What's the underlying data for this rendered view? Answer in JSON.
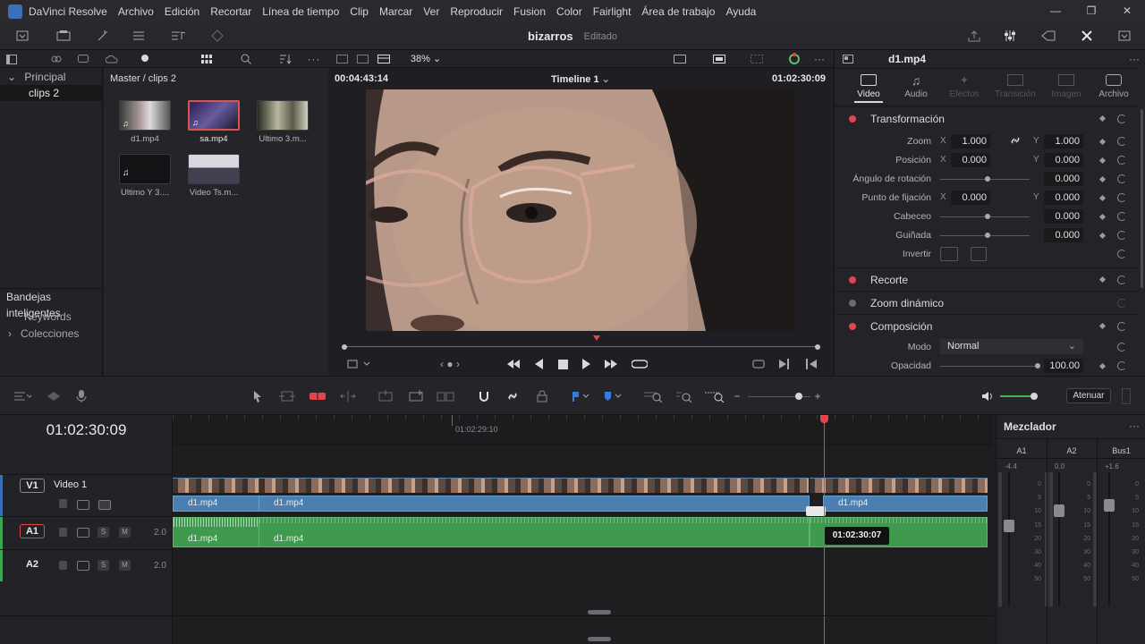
{
  "app": {
    "name": "DaVinci Resolve",
    "menu": [
      "Archivo",
      "Edición",
      "Recortar",
      "Línea de tiempo",
      "Clip",
      "Marcar",
      "Ver",
      "Reproducir",
      "Fusion",
      "Color",
      "Fairlight",
      "Área de trabajo",
      "Ayuda"
    ]
  },
  "project": {
    "title": "bizarros",
    "status": "Editado"
  },
  "toolbar2": {
    "zoom": "38%"
  },
  "bins": {
    "master": "Principal",
    "sub": "clips 2",
    "smart": "Bandejas inteligentes",
    "keywords": "Keywords",
    "collections": "Colecciones"
  },
  "pool": {
    "breadcrumb": "Master / clips 2",
    "clips": [
      {
        "name": "d1.mp4",
        "selected": false,
        "audio": true
      },
      {
        "name": "sa.mp4",
        "selected": true,
        "audio": true
      },
      {
        "name": "Ultimo 3.m...",
        "selected": false,
        "audio": false
      },
      {
        "name": "Ultimo Y 3....",
        "selected": false,
        "audio": true
      },
      {
        "name": "Video Ts.m...",
        "selected": false,
        "audio": false
      }
    ]
  },
  "viewer": {
    "duration": "00:04:43:14",
    "timeline": "Timeline 1",
    "timecode": "01:02:30:09"
  },
  "inspector": {
    "clip": "d1.mp4",
    "tabs": [
      "Video",
      "Audio",
      "Efectos",
      "Transición",
      "Imagen",
      "Archivo"
    ],
    "transform": {
      "title": "Transformación",
      "zoom_label": "Zoom",
      "zoom_x": "1.000",
      "zoom_y": "1.000",
      "pos_label": "Posición",
      "pos_x": "0.000",
      "pos_y": "0.000",
      "rot_label": "Ángulo de rotación",
      "rot": "0.000",
      "anchor_label": "Punto de fijación",
      "anchor_x": "0.000",
      "anchor_y": "0.000",
      "pitch_label": "Cabeceo",
      "pitch": "0.000",
      "yaw_label": "Guiñada",
      "yaw": "0.000",
      "flip_label": "Invertir",
      "x": "X",
      "y": "Y"
    },
    "crop": "Recorte",
    "dynzoom": "Zoom dinámico",
    "comp": {
      "title": "Composición",
      "mode_label": "Modo",
      "mode": "Normal",
      "opacity_label": "Opacidad",
      "opacity": "100.00"
    }
  },
  "timeline": {
    "timecode": "01:02:30:09",
    "ruler_tc": "01:02:29:10",
    "tooltip": "01:02:30:07",
    "mute": "Atenuar",
    "tracks": {
      "v1": "V1",
      "v1_name": "Video 1",
      "a1": "A1",
      "a2": "A2",
      "a1_ch": "2.0",
      "a2_ch": "2.0",
      "s": "S",
      "m": "M"
    },
    "clip_name": "d1.mp4"
  },
  "mixer": {
    "title": "Mezclador",
    "channels": [
      "A1",
      "A2",
      "Bus1"
    ],
    "levels": [
      "-4.4",
      "0.0",
      "+1.6"
    ],
    "scale": [
      "0",
      "5",
      "10",
      "15",
      "20",
      "30",
      "40",
      "50"
    ]
  }
}
